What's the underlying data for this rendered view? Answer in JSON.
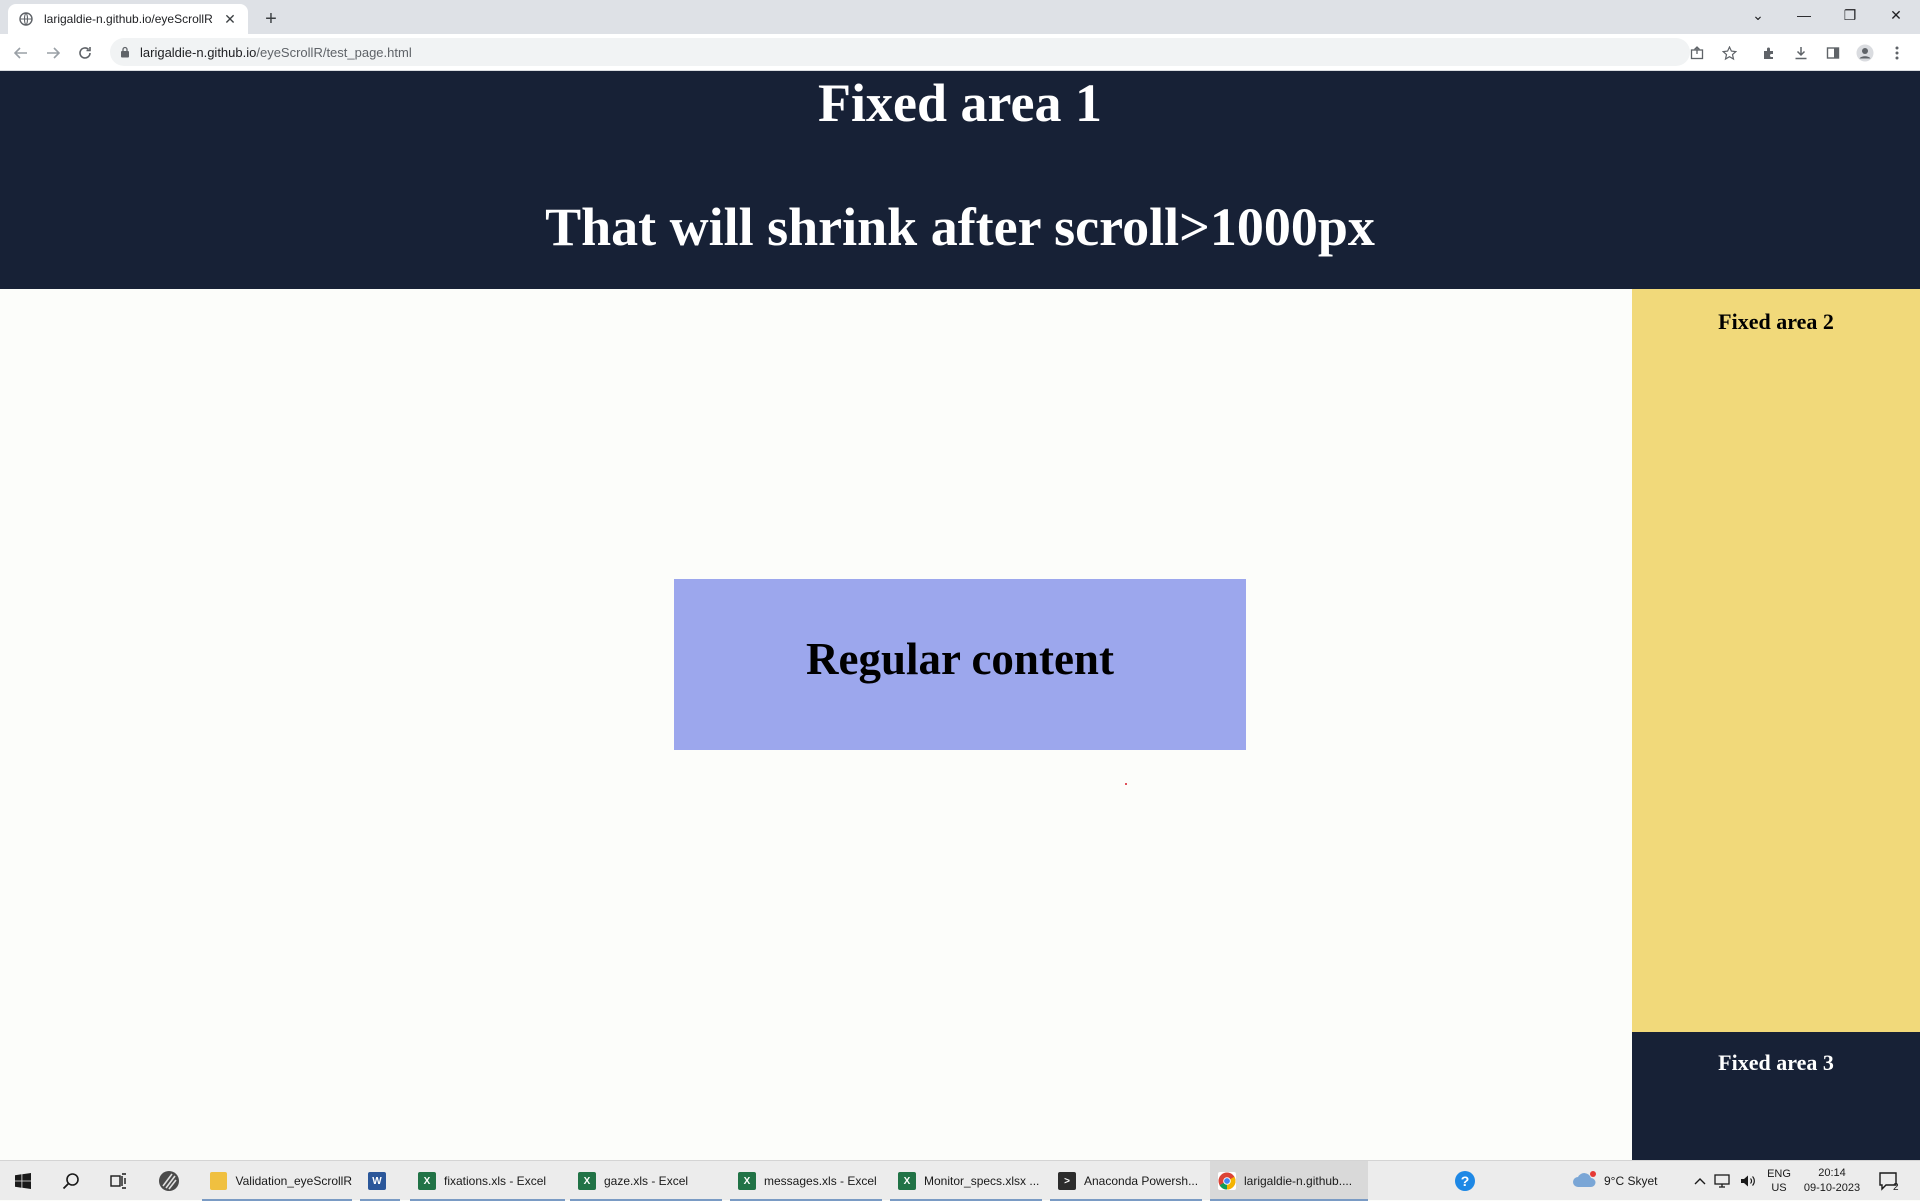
{
  "browser": {
    "tab_title": "larigaldie-n.github.io/eyeScrollR",
    "url_host": "larigaldie-n.github.io",
    "url_path": "/eyeScrollR/test_page.html"
  },
  "page": {
    "fixed_area_1_line1": "Fixed area 1",
    "fixed_area_1_line2": "That will shrink after scroll>1000px",
    "regular_content": "Regular content",
    "fixed_area_2": "Fixed area 2",
    "fixed_area_3": "Fixed area 3"
  },
  "taskbar": {
    "apps": [
      {
        "label": "Validation_eyeScrollR",
        "icon": "folder-icon"
      },
      {
        "label": "",
        "icon": "word-icon"
      },
      {
        "label": "fixations.xls - Excel",
        "icon": "excel-icon"
      },
      {
        "label": "gaze.xls - Excel",
        "icon": "excel-icon"
      },
      {
        "label": "messages.xls - Excel",
        "icon": "excel-icon"
      },
      {
        "label": "Monitor_specs.xlsx ...",
        "icon": "excel-icon"
      },
      {
        "label": "Anaconda Powersh...",
        "icon": "terminal-icon"
      },
      {
        "label": "larigaldie-n.github....",
        "icon": "chrome-icon"
      }
    ],
    "weather": "9°C  Skyet",
    "language": "ENG",
    "region": "US",
    "time": "20:14",
    "date": "09-10-2023",
    "notification_count": "2"
  },
  "colors": {
    "header_bg": "#172136",
    "regular_bg": "#9ca7ed",
    "sidebar_bg": "#f1d97a",
    "page_bg": "#fcfdfa"
  }
}
